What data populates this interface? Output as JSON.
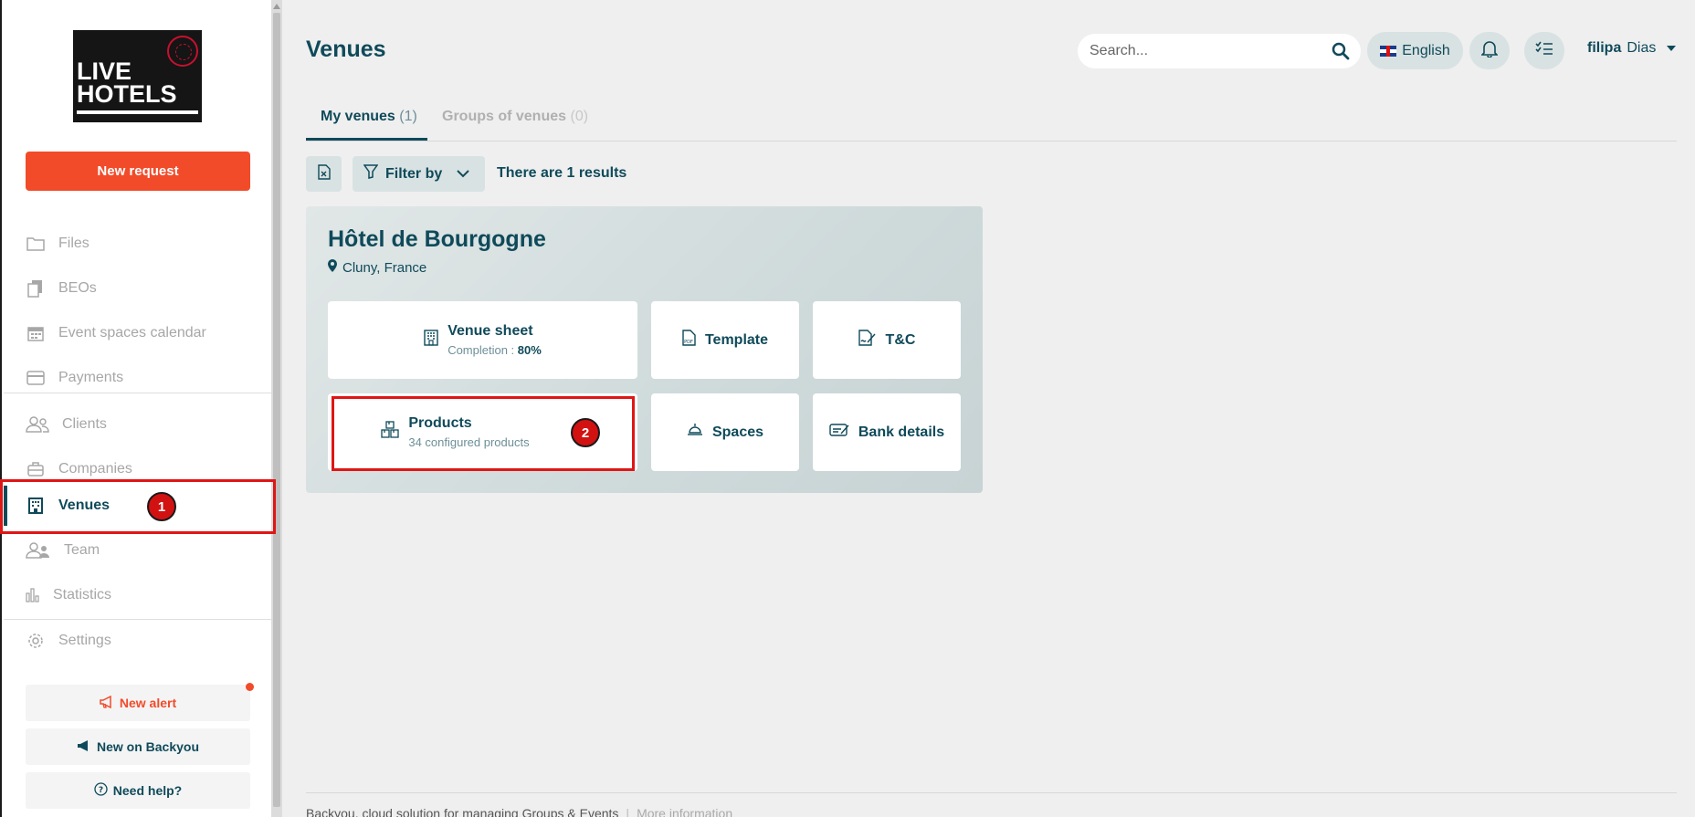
{
  "brand": {
    "logo_line1": "LIVE",
    "logo_line2": "HOTELS"
  },
  "sidebar": {
    "new_request": "New request",
    "items": [
      {
        "label": "Files",
        "icon": "folder-icon"
      },
      {
        "label": "BEOs",
        "icon": "documents-icon"
      },
      {
        "label": "Event spaces calendar",
        "icon": "calendar-icon"
      },
      {
        "label": "Payments",
        "icon": "credit-card-icon"
      },
      {
        "label": "Clients",
        "icon": "users-icon"
      },
      {
        "label": "Companies",
        "icon": "briefcase-icon"
      },
      {
        "label": "Venues",
        "icon": "building-icon",
        "active": true
      },
      {
        "label": "Team",
        "icon": "team-icon"
      },
      {
        "label": "Statistics",
        "icon": "bar-chart-icon"
      },
      {
        "label": "Settings",
        "icon": "gear-icon"
      }
    ],
    "new_alert": "New alert",
    "new_on_backyou": "New on Backyou",
    "need_help": "Need help?"
  },
  "header": {
    "title": "Venues",
    "search_placeholder": "Search...",
    "language": "English",
    "user_first": "filipa",
    "user_last": "Dias"
  },
  "tabs": [
    {
      "label": "My venues",
      "count": "(1)",
      "active": true
    },
    {
      "label": "Groups of venues",
      "count": "(0)",
      "active": false
    }
  ],
  "toolbar": {
    "filter_label": "Filter by",
    "results_text": "There are 1 results"
  },
  "venue": {
    "name": "Hôtel de Bourgogne",
    "location": "Cluny, France",
    "tiles": {
      "venue_sheet": {
        "title": "Venue sheet",
        "sub_prefix": "Completion : ",
        "sub_value": "80%"
      },
      "template": {
        "title": "Template"
      },
      "tc": {
        "title": "T&C"
      },
      "products": {
        "title": "Products",
        "sub": "34 configured products"
      },
      "spaces": {
        "title": "Spaces"
      },
      "bank": {
        "title": "Bank details"
      }
    }
  },
  "annotations": {
    "badge1": "1",
    "badge2": "2"
  },
  "footer": {
    "text": "Backyou, cloud solution for managing Groups & Events",
    "more": "More information"
  },
  "colors": {
    "primary": "#0f4a5a",
    "accent": "#f24b2a",
    "highlight": "#e01515"
  }
}
